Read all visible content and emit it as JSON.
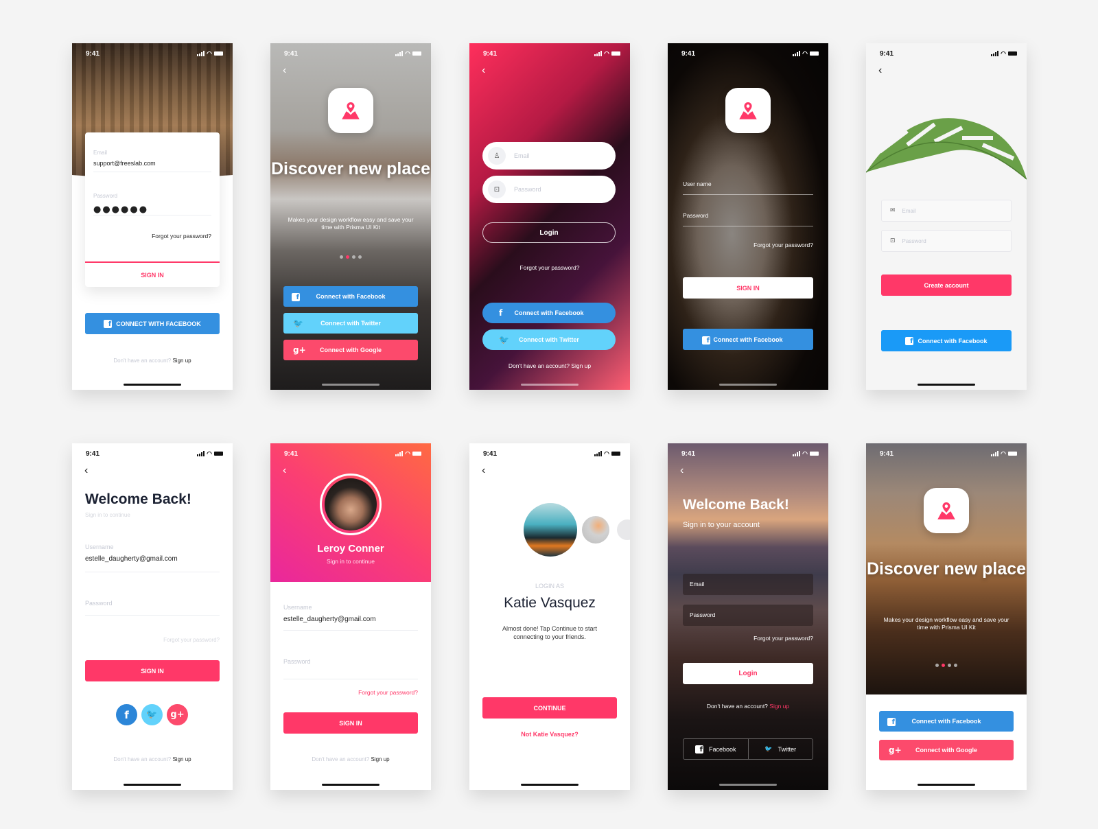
{
  "status_time": "9:41",
  "colors": {
    "accent": "#ff3868",
    "facebook": "#3490e0",
    "twitter": "#62d2fb",
    "google": "#fc4a6c"
  },
  "screens": {
    "s1": {
      "email_label": "Email",
      "email_value": "support@freeslab.com",
      "password_label": "Password",
      "password_mask": "●●●●●●",
      "forgot": "Forgot your password?",
      "signin": "SIGN IN",
      "facebook": "CONNECT WITH FACEBOOK",
      "no_account": "Don't have an account?",
      "signup": "Sign up"
    },
    "s2": {
      "title": "Discover new place",
      "subtitle": "Makes your design workflow easy and save your time with Prisma UI Kit",
      "pager": {
        "total": 4,
        "active": 2
      },
      "facebook": "Connect with Facebook",
      "twitter": "Connect with Twitter",
      "google": "Connect with Google"
    },
    "s3": {
      "email_placeholder": "Email",
      "password_placeholder": "Password",
      "login": "Login",
      "forgot": "Forgot your password?",
      "facebook": "Connect with Facebook",
      "twitter": "Connect with Twitter",
      "no_account": "Don't have an account? Sign up"
    },
    "s4": {
      "username_label": "User name",
      "password_label": "Password",
      "forgot": "Forgot your password?",
      "signin": "SIGN IN",
      "facebook": "Connect with Facebook"
    },
    "s5": {
      "email_placeholder": "Email",
      "password_placeholder": "Password",
      "create": "Create account",
      "facebook": "Connect with Facebook"
    },
    "s6": {
      "title": "Welcome Back!",
      "subtitle": "Sign in to continue",
      "username_label": "Username",
      "username_value": "estelle_daugherty@gmail.com",
      "password_label": "Password",
      "forgot": "Forgot your password?",
      "signin": "SIGN IN",
      "no_account": "Don't have an account?",
      "signup": "Sign up"
    },
    "s7": {
      "name": "Leroy Conner",
      "subtitle": "Sign in to continue",
      "username_label": "Username",
      "username_value": "estelle_daugherty@gmail.com",
      "password_label": "Password",
      "forgot": "Forgot your password?",
      "signin": "SIGN IN",
      "no_account": "Don't have an account?",
      "signup": "Sign up"
    },
    "s8": {
      "login_as": "LOGIN AS",
      "name": "Katie Vasquez",
      "message": "Almost done! Tap Continue to start connecting to your friends.",
      "continue": "CONTINUE",
      "not_user": "Not Katie Vasquez?"
    },
    "s9": {
      "title": "Welcome Back!",
      "subtitle": "Sign in to your account",
      "email_label": "Email",
      "password_label": "Password",
      "forgot": "Forgot your password?",
      "login": "Login",
      "no_account": "Don't have an account?",
      "signup": "Sign up",
      "facebook": "Facebook",
      "twitter": "Twitter"
    },
    "s10": {
      "title": "Discover new place",
      "subtitle": "Makes your design workflow easy and save your time with Prisma UI Kit",
      "pager": {
        "total": 4,
        "active": 2
      },
      "facebook": "Connect with Facebook",
      "google": "Connect with Google"
    }
  },
  "icons": {
    "back": "‹",
    "facebook": "f",
    "twitter": "🐦",
    "google": "g+",
    "user": "👤",
    "lock": "🔒",
    "mail": "✉",
    "location": "location-pin-map-icon"
  }
}
